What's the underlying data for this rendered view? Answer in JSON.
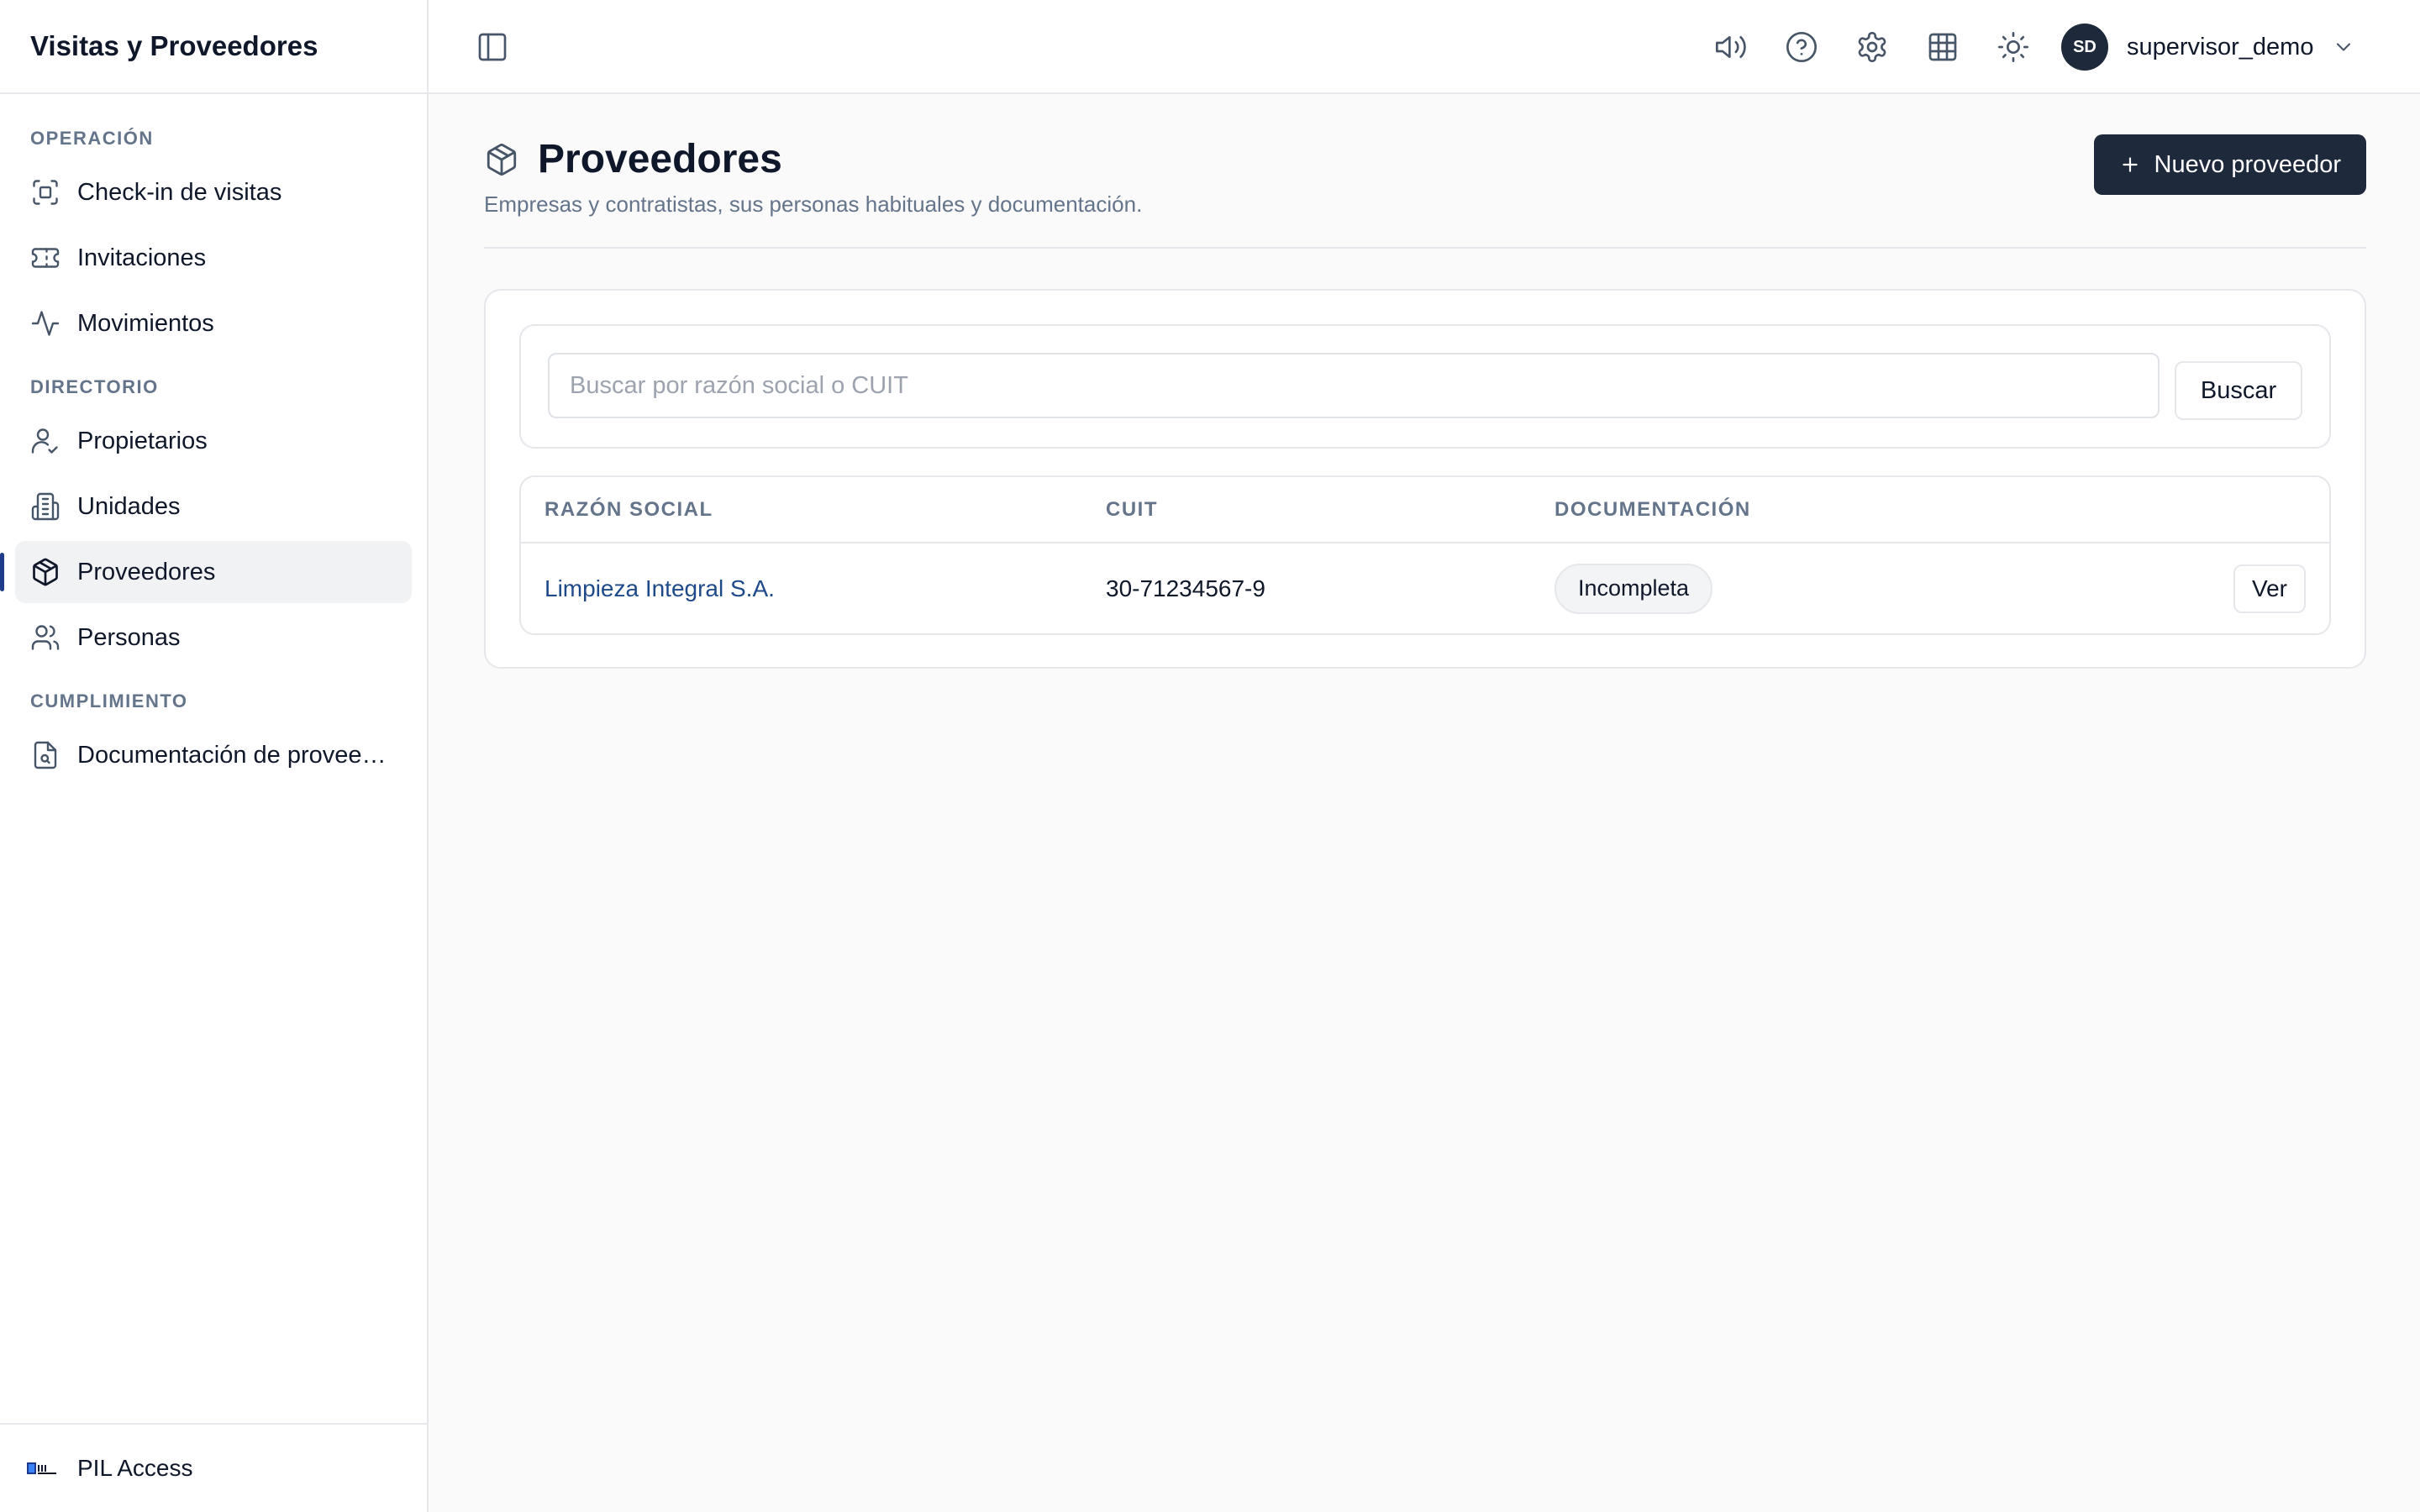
{
  "sidebar": {
    "app_title": "Visitas y Proveedores",
    "sections": [
      {
        "label": "OPERACIÓN",
        "items": [
          {
            "label": "Check-in de visitas",
            "icon": "scan-icon"
          },
          {
            "label": "Invitaciones",
            "icon": "ticket-icon"
          },
          {
            "label": "Movimientos",
            "icon": "activity-icon"
          }
        ]
      },
      {
        "label": "DIRECTORIO",
        "items": [
          {
            "label": "Propietarios",
            "icon": "user-check-icon"
          },
          {
            "label": "Unidades",
            "icon": "building-icon"
          },
          {
            "label": "Proveedores",
            "icon": "package-icon",
            "active": true
          },
          {
            "label": "Personas",
            "icon": "users-icon"
          }
        ]
      },
      {
        "label": "CUMPLIMIENTO",
        "items": [
          {
            "label": "Documentación de proveedores",
            "icon": "file-search-icon"
          }
        ]
      }
    ],
    "footer": {
      "brand": "PIL Access",
      "logo_text": "PIL"
    }
  },
  "topbar": {
    "icons": [
      "sidebar-toggle-icon",
      "megaphone-icon",
      "help-icon",
      "settings-icon",
      "grid-icon",
      "sun-icon"
    ],
    "user": {
      "initials": "SD",
      "name": "supervisor_demo"
    }
  },
  "page": {
    "title": "Proveedores",
    "subtitle": "Empresas y contratistas, sus personas habituales y documentación.",
    "new_button": "Nuevo proveedor"
  },
  "search": {
    "placeholder": "Buscar por razón social o CUIT",
    "value": "",
    "button": "Buscar"
  },
  "table": {
    "headers": [
      "RAZÓN SOCIAL",
      "CUIT",
      "DOCUMENTACIÓN",
      ""
    ],
    "rows": [
      {
        "razon_social": "Limpieza Integral S.A.",
        "cuit": "30-71234567-9",
        "documentacion": "Incompleta",
        "action": "Ver"
      }
    ]
  },
  "colors": {
    "accent": "#1e293b",
    "link": "#1e4a8a",
    "active_bar": "#1e3a8a"
  }
}
